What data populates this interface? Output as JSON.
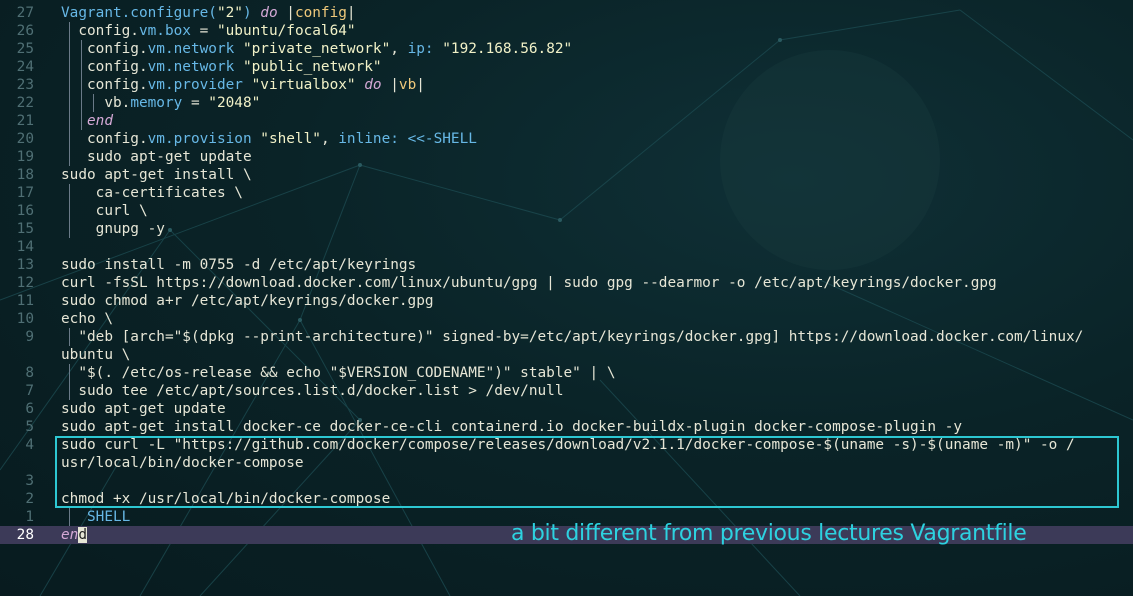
{
  "editor": {
    "lines": [
      {
        "num": "27",
        "segments": [
          {
            "t": "Vagrant.configure(",
            "c": "blue"
          },
          {
            "t": "\"2\"",
            "c": "str"
          },
          {
            "t": ") ",
            "c": "blue"
          },
          {
            "t": "do",
            "c": "kw"
          },
          {
            "t": " |",
            "c": ""
          },
          {
            "t": "config",
            "c": "yellow"
          },
          {
            "t": "|",
            "c": ""
          }
        ]
      },
      {
        "num": "26",
        "segments": [
          {
            "t": "  config.",
            "c": ""
          },
          {
            "t": "vm.box",
            "c": "blue"
          },
          {
            "t": " = ",
            "c": ""
          },
          {
            "t": "\"ubuntu/focal64\"",
            "c": "str"
          }
        ]
      },
      {
        "num": "25",
        "segments": [
          {
            "t": "   config.",
            "c": ""
          },
          {
            "t": "vm.network",
            "c": "blue"
          },
          {
            "t": " ",
            "c": ""
          },
          {
            "t": "\"private_network\"",
            "c": "str"
          },
          {
            "t": ", ",
            "c": ""
          },
          {
            "t": "ip:",
            "c": "blue"
          },
          {
            "t": " ",
            "c": ""
          },
          {
            "t": "\"192.168.56.82\"",
            "c": "str"
          }
        ]
      },
      {
        "num": "24",
        "segments": [
          {
            "t": "   config.",
            "c": ""
          },
          {
            "t": "vm.network",
            "c": "blue"
          },
          {
            "t": " ",
            "c": ""
          },
          {
            "t": "\"public_network\"",
            "c": "str"
          }
        ]
      },
      {
        "num": "23",
        "segments": [
          {
            "t": "   config.",
            "c": ""
          },
          {
            "t": "vm.provider",
            "c": "blue"
          },
          {
            "t": " ",
            "c": ""
          },
          {
            "t": "\"virtualbox\"",
            "c": "str"
          },
          {
            "t": " ",
            "c": ""
          },
          {
            "t": "do",
            "c": "kw"
          },
          {
            "t": " |",
            "c": ""
          },
          {
            "t": "vb",
            "c": "yellow"
          },
          {
            "t": "|",
            "c": ""
          }
        ]
      },
      {
        "num": "22",
        "segments": [
          {
            "t": "     vb.",
            "c": ""
          },
          {
            "t": "memory",
            "c": "blue"
          },
          {
            "t": " = ",
            "c": ""
          },
          {
            "t": "\"2048\"",
            "c": "str"
          }
        ]
      },
      {
        "num": "21",
        "segments": [
          {
            "t": "   ",
            "c": ""
          },
          {
            "t": "end",
            "c": "kw"
          }
        ]
      },
      {
        "num": "20",
        "segments": [
          {
            "t": "   config.",
            "c": ""
          },
          {
            "t": "vm.provision",
            "c": "blue"
          },
          {
            "t": " ",
            "c": ""
          },
          {
            "t": "\"shell\"",
            "c": "str"
          },
          {
            "t": ", ",
            "c": ""
          },
          {
            "t": "inline:",
            "c": "blue"
          },
          {
            "t": " ",
            "c": ""
          },
          {
            "t": "<<-SHELL",
            "c": "blue"
          }
        ]
      },
      {
        "num": "19",
        "segments": [
          {
            "t": "   sudo apt-get update",
            "c": ""
          }
        ]
      },
      {
        "num": "18",
        "segments": [
          {
            "t": "sudo apt-get install \\",
            "c": ""
          }
        ]
      },
      {
        "num": "17",
        "segments": [
          {
            "t": "    ca-certificates \\",
            "c": ""
          }
        ]
      },
      {
        "num": "16",
        "segments": [
          {
            "t": "    curl \\",
            "c": ""
          }
        ]
      },
      {
        "num": "15",
        "segments": [
          {
            "t": "    gnupg -y",
            "c": ""
          }
        ]
      },
      {
        "num": "14",
        "segments": []
      },
      {
        "num": "13",
        "segments": [
          {
            "t": "sudo install -m 0755 -d /etc/apt/keyrings",
            "c": ""
          }
        ]
      },
      {
        "num": "12",
        "segments": [
          {
            "t": "curl -fsSL https://download.docker.com/linux/ubuntu/gpg | sudo gpg --dearmor -o /etc/apt/keyrings/docker.gpg",
            "c": ""
          }
        ]
      },
      {
        "num": "11",
        "segments": [
          {
            "t": "sudo chmod a+r /etc/apt/keyrings/docker.gpg",
            "c": ""
          }
        ]
      },
      {
        "num": "10",
        "segments": [
          {
            "t": "echo \\",
            "c": ""
          }
        ]
      },
      {
        "num": "9",
        "segments": [
          {
            "t": "  \"deb [arch=\"$(dpkg --print-architecture)\" signed-by=/etc/apt/keyrings/docker.gpg] https://download.docker.com/linux/",
            "c": ""
          }
        ]
      },
      {
        "num": "",
        "segments": [
          {
            "t": "ubuntu \\",
            "c": ""
          }
        ]
      },
      {
        "num": "8",
        "segments": [
          {
            "t": "  \"$(. /etc/os-release && echo \"$VERSION_CODENAME\")\" stable\" | \\",
            "c": ""
          }
        ]
      },
      {
        "num": "7",
        "segments": [
          {
            "t": "  sudo tee /etc/apt/sources.list.d/docker.list > /dev/null",
            "c": ""
          }
        ]
      },
      {
        "num": "6",
        "segments": [
          {
            "t": "sudo apt-get update",
            "c": ""
          }
        ]
      },
      {
        "num": "5",
        "segments": [
          {
            "t": "sudo apt-get install docker-ce docker-ce-cli containerd.io docker-buildx-plugin docker-compose-plugin -y",
            "c": ""
          }
        ]
      },
      {
        "num": "4",
        "segments": [
          {
            "t": "sudo curl -L \"https://github.com/docker/compose/releases/download/v2.1.1/docker-compose-$(uname -s)-$(uname -m)\" -o /",
            "c": ""
          }
        ]
      },
      {
        "num": "",
        "segments": [
          {
            "t": "usr/local/bin/docker-compose",
            "c": ""
          }
        ]
      },
      {
        "num": "3",
        "segments": []
      },
      {
        "num": "2",
        "segments": [
          {
            "t": "chmod +x /usr/local/bin/docker-compose",
            "c": ""
          }
        ]
      },
      {
        "num": "1",
        "segments": [
          {
            "t": "   SHELL",
            "c": "blue"
          }
        ]
      },
      {
        "num": "28",
        "segments": [
          {
            "t": "end",
            "c": "kw"
          }
        ],
        "current": true
      }
    ]
  },
  "annotation": {
    "text": "a bit different from previous lectures Vagrantfile"
  },
  "colors": {
    "background": "#0a2327",
    "annotation": "#2dd2e0",
    "selection_border": "#2dc7d2",
    "cursorline": "#3c3a58"
  }
}
